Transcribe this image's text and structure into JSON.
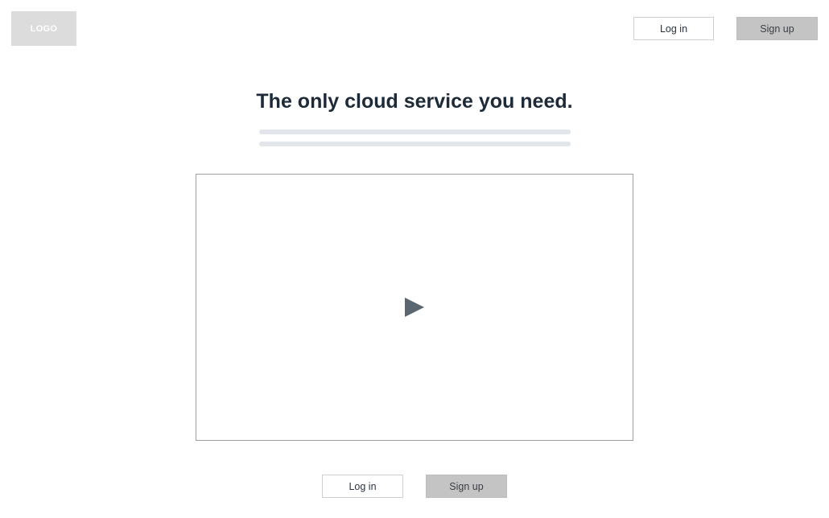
{
  "header": {
    "logo_text": "LOGO",
    "login_label": "Log in",
    "signup_label": "Sign up"
  },
  "hero": {
    "headline": "The only cloud service you need."
  },
  "video": {
    "play_icon": "play-icon"
  },
  "footer_actions": {
    "login_label": "Log in",
    "signup_label": "Sign up"
  },
  "colors": {
    "headline": "#1e2a38",
    "signup_fill": "#c4c4c4",
    "logo_fill": "#dcdcdc",
    "placeholder_line": "#e2e5e9",
    "play_icon": "#5b6770"
  }
}
